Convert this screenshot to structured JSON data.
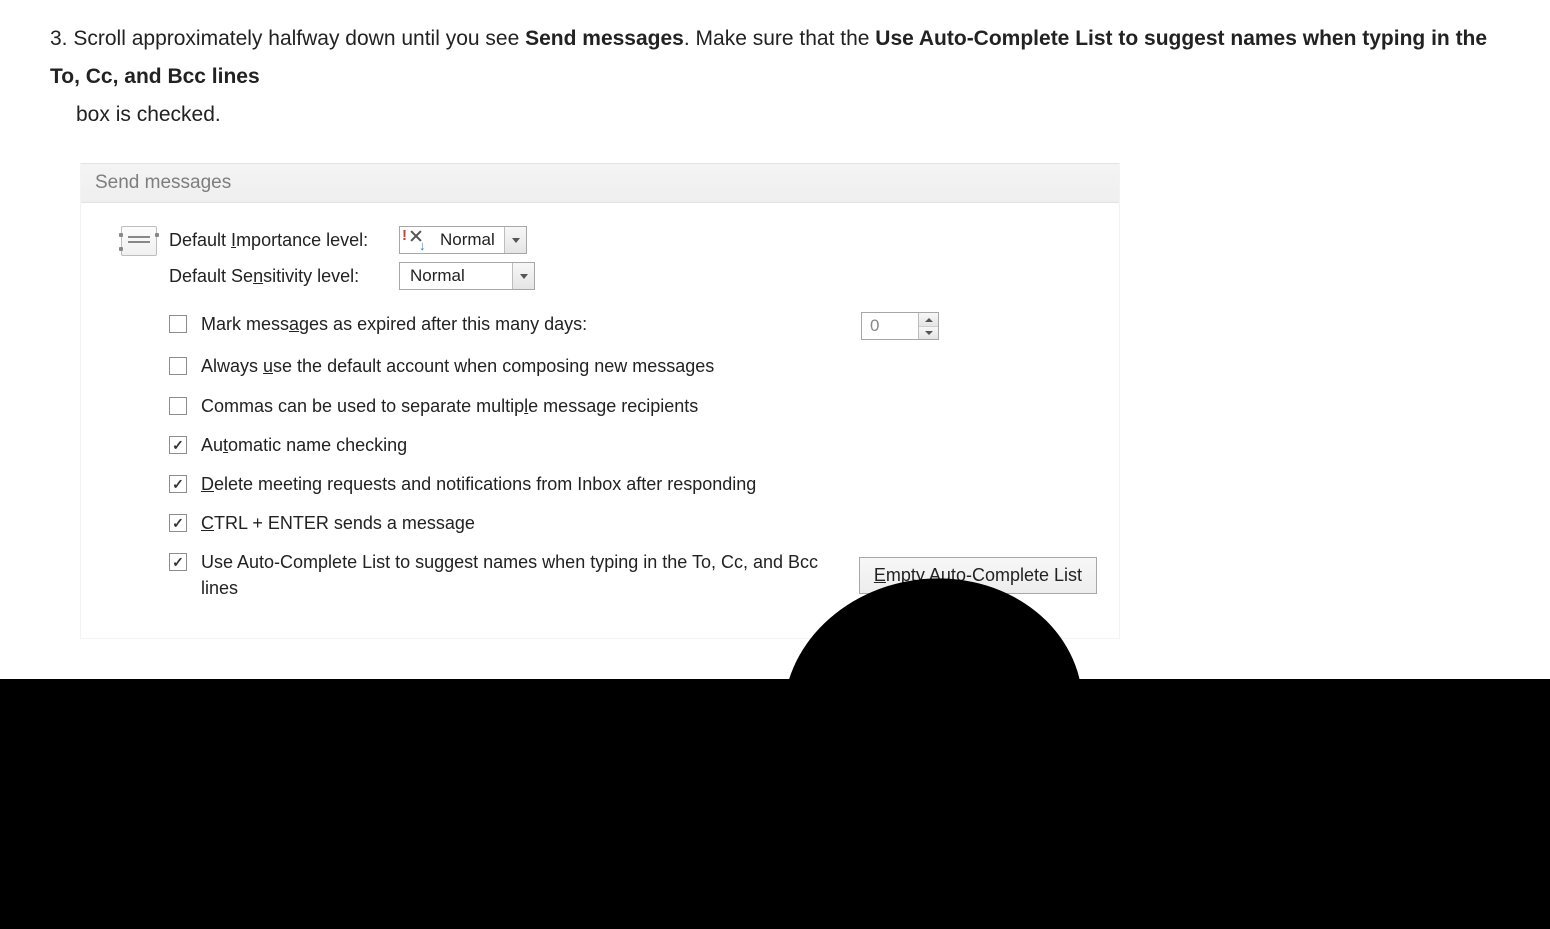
{
  "instruction": {
    "number": "3.",
    "text_before": "Scroll approximately halfway down until you see ",
    "bold1": "Send messages",
    "text_mid": ". Make sure that the ",
    "bold2": "Use Auto-Complete List to suggest names when typing in the To, Cc, and Bcc lines ",
    "text_after": "box is checked."
  },
  "panel": {
    "header": "Send messages",
    "defaults": {
      "importance_label_pre": "Default ",
      "importance_mnemonic": "I",
      "importance_label_post": "mportance level:",
      "importance_value": "Normal",
      "sensitivity_label_pre": "Default Se",
      "sensitivity_mnemonic": "n",
      "sensitivity_label_post": "sitivity level:",
      "sensitivity_value": "Normal"
    },
    "checks": {
      "c1_pre": "Mark mess",
      "c1_mn": "a",
      "c1_post": "ges as expired after this many days:",
      "c1_checked": false,
      "c1_days": "0",
      "c2_pre": "Always ",
      "c2_mn": "u",
      "c2_post": "se the default account when composing new messages",
      "c2_checked": false,
      "c3_pre": "Commas can be used to separate multip",
      "c3_mn": "l",
      "c3_post": "e message recipients",
      "c3_checked": false,
      "c4_pre": "Au",
      "c4_mn": "t",
      "c4_post": "omatic name checking",
      "c4_checked": true,
      "c5_pre": "",
      "c5_mn": "D",
      "c5_post": "elete meeting requests and notifications from Inbox after responding",
      "c5_checked": true,
      "c6_pre": "",
      "c6_mn": "C",
      "c6_post": "TRL + ENTER sends a message",
      "c6_checked": true,
      "c7_text": "Use Auto-Complete List to suggest names when typing in the To, Cc, and Bcc lines",
      "c7_checked": true
    },
    "button_pre": "",
    "button_mn": "E",
    "button_post": "mpty Auto-Complete List"
  }
}
